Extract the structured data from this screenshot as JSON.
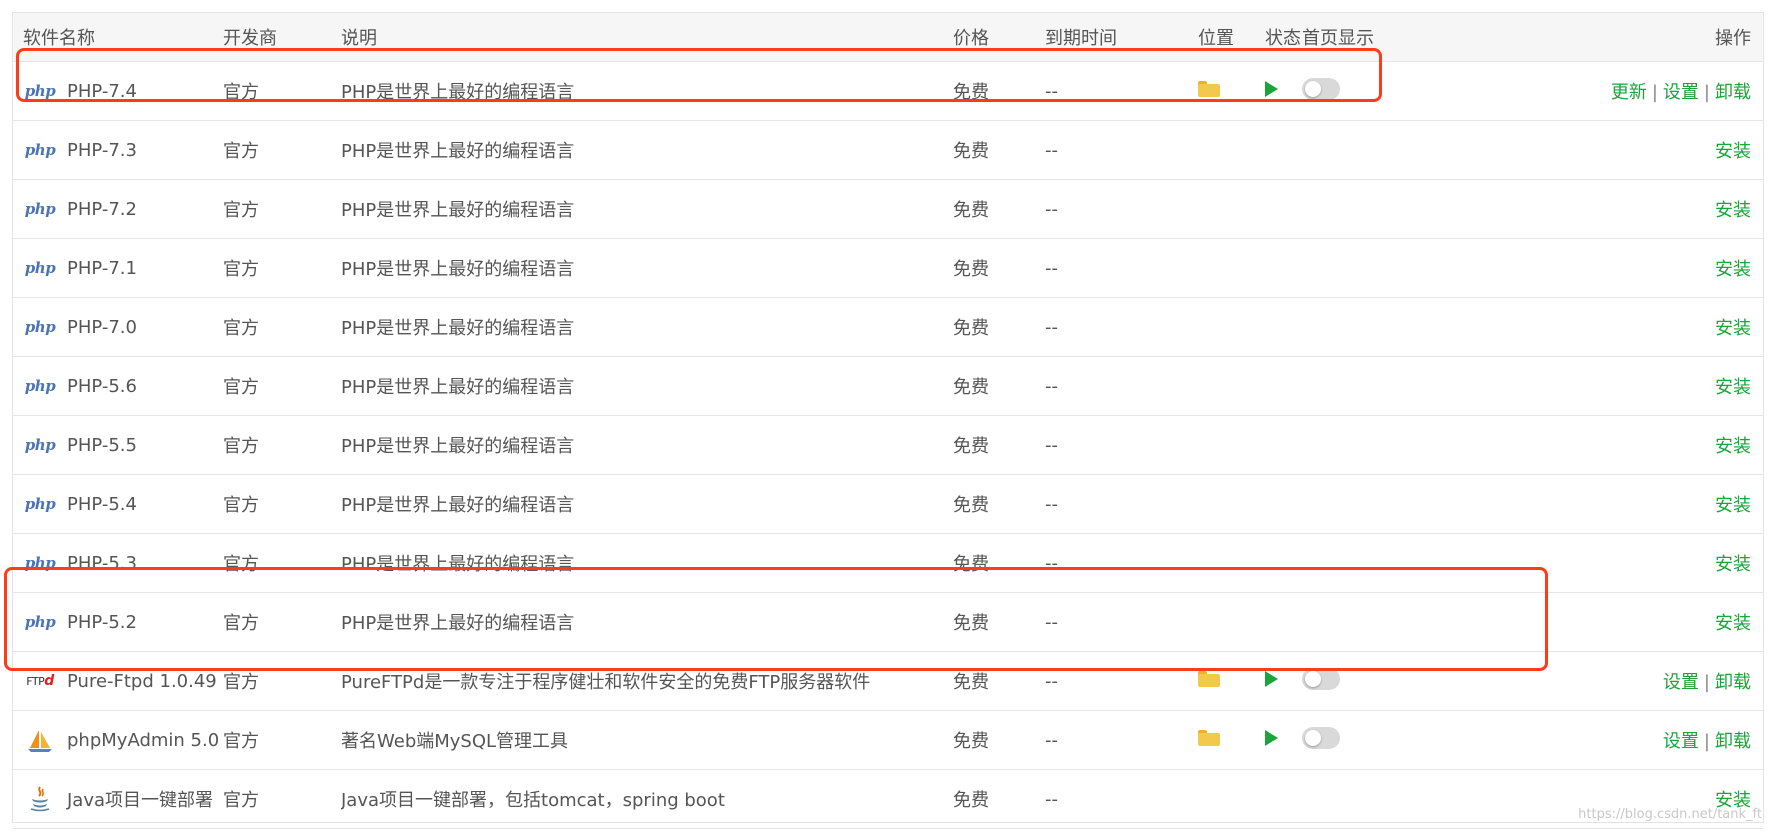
{
  "columns": {
    "name": "软件名称",
    "developer": "开发商",
    "description": "说明",
    "price": "价格",
    "expire": "到期时间",
    "location": "位置",
    "status": "状态",
    "homepage": "首页显示",
    "actions": "操作"
  },
  "rows": [
    {
      "name": "PHP-7.4",
      "icon": "php-icon",
      "developer": "官方",
      "description": "PHP是世界上最好的编程语言",
      "price": "免费",
      "expire": "--",
      "installed": true,
      "actions": [
        "更新",
        "设置",
        "卸载"
      ]
    },
    {
      "name": "PHP-7.3",
      "icon": "php-icon",
      "developer": "官方",
      "description": "PHP是世界上最好的编程语言",
      "price": "免费",
      "expire": "--",
      "installed": false,
      "actions": [
        "安装"
      ]
    },
    {
      "name": "PHP-7.2",
      "icon": "php-icon",
      "developer": "官方",
      "description": "PHP是世界上最好的编程语言",
      "price": "免费",
      "expire": "--",
      "installed": false,
      "actions": [
        "安装"
      ]
    },
    {
      "name": "PHP-7.1",
      "icon": "php-icon",
      "developer": "官方",
      "description": "PHP是世界上最好的编程语言",
      "price": "免费",
      "expire": "--",
      "installed": false,
      "actions": [
        "安装"
      ]
    },
    {
      "name": "PHP-7.0",
      "icon": "php-icon",
      "developer": "官方",
      "description": "PHP是世界上最好的编程语言",
      "price": "免费",
      "expire": "--",
      "installed": false,
      "actions": [
        "安装"
      ]
    },
    {
      "name": "PHP-5.6",
      "icon": "php-icon",
      "developer": "官方",
      "description": "PHP是世界上最好的编程语言",
      "price": "免费",
      "expire": "--",
      "installed": false,
      "actions": [
        "安装"
      ]
    },
    {
      "name": "PHP-5.5",
      "icon": "php-icon",
      "developer": "官方",
      "description": "PHP是世界上最好的编程语言",
      "price": "免费",
      "expire": "--",
      "installed": false,
      "actions": [
        "安装"
      ]
    },
    {
      "name": "PHP-5.4",
      "icon": "php-icon",
      "developer": "官方",
      "description": "PHP是世界上最好的编程语言",
      "price": "免费",
      "expire": "--",
      "installed": false,
      "actions": [
        "安装"
      ]
    },
    {
      "name": "PHP-5.3",
      "icon": "php-icon",
      "developer": "官方",
      "description": "PHP是世界上最好的编程语言",
      "price": "免费",
      "expire": "--",
      "installed": false,
      "actions": [
        "安装"
      ]
    },
    {
      "name": "PHP-5.2",
      "icon": "php-icon",
      "developer": "官方",
      "description": "PHP是世界上最好的编程语言",
      "price": "免费",
      "expire": "--",
      "installed": false,
      "actions": [
        "安装"
      ]
    },
    {
      "name": "Pure-Ftpd 1.0.49",
      "icon": "ftp-icon",
      "developer": "官方",
      "description": "PureFTPd是一款专注于程序健壮和软件安全的免费FTP服务器软件",
      "price": "免费",
      "expire": "--",
      "installed": true,
      "actions": [
        "设置",
        "卸载"
      ]
    },
    {
      "name": "phpMyAdmin 5.0",
      "icon": "phpmyadmin-icon",
      "developer": "官方",
      "description": "著名Web端MySQL管理工具",
      "price": "免费",
      "expire": "--",
      "installed": true,
      "actions": [
        "设置",
        "卸载"
      ]
    },
    {
      "name": "Java项目一键部署",
      "icon": "java-icon",
      "developer": "官方",
      "description": "Java项目一键部署，包括tomcat，spring boot",
      "price": "免费",
      "expire": "--",
      "installed": false,
      "actions": [
        "安装"
      ]
    }
  ],
  "icon_text": {
    "php": "php",
    "ftp_prefix": "FTP",
    "ftp_mark": "d"
  },
  "watermark": "https://blog.csdn.net/tank_ft",
  "colors": {
    "action_link": "#1aa53a",
    "highlight": "#ff3c1a",
    "folder": "#f2c94c",
    "play": "#1aa53a"
  }
}
